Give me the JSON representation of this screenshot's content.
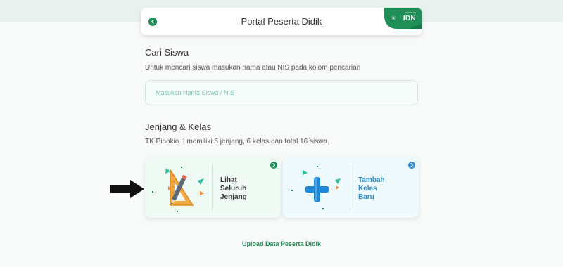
{
  "header": {
    "title": "Portal Peserta Didik",
    "logo_small": "GERAKAN",
    "logo_text": "IDN",
    "back_icon": "chevron-left-icon"
  },
  "search_section": {
    "title": "Cari Siswa",
    "description": "Untuk mencari siswa masukan nama atau NIS pada kolom pencarian",
    "input_value": "",
    "input_placeholder": "Masukan Nama Siswa / NIS"
  },
  "level_section": {
    "title": "Jenjang & Kelas",
    "description": "TK Pinokio II memiliki 5 jenjang, 6 kelas dan total 16 siswa."
  },
  "cards": [
    {
      "label_lines": [
        "Lihat",
        "Seluruh",
        "Jenjang"
      ],
      "icon": "ruler-pencil-icon",
      "color": "#1e8f56"
    },
    {
      "label_lines": [
        "Tambah",
        "Kelas",
        "Baru"
      ],
      "icon": "plus-icon",
      "color": "#2d8ed1"
    }
  ],
  "footer": {
    "upload_label": "Upload Data Peserta Didik"
  },
  "colors": {
    "primary_green": "#1e8f56",
    "accent_blue": "#2d8ed1"
  }
}
